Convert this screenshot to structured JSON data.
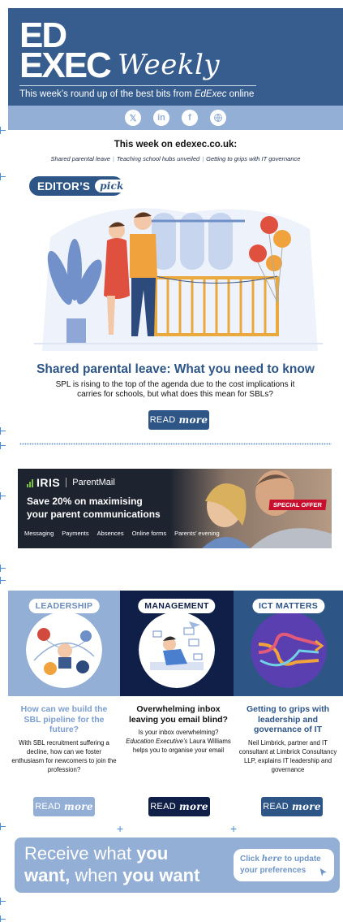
{
  "header": {
    "logo_line1": "ED",
    "logo_line2": "EXEC",
    "logo_script": "Weekly",
    "tagline_prefix": "This week’s round up of the best bits from ",
    "tagline_brand": "EdExec",
    "tagline_suffix": " online",
    "colors": {
      "masthead": "#365d8e",
      "social_bar": "#93afd6"
    }
  },
  "social": [
    {
      "icon": "x-icon",
      "glyph": "𝕏"
    },
    {
      "icon": "linkedin-icon",
      "glyph": "in"
    },
    {
      "icon": "facebook-icon",
      "glyph": "f"
    },
    {
      "icon": "globe-icon",
      "glyph": ""
    }
  ],
  "this_week": {
    "title": "This week on edexec.co.uk:",
    "links": [
      "Shared parental leave",
      "Teaching school hubs unveiled",
      "Getting to grips with IT governance"
    ],
    "separator": "|"
  },
  "editors_pick": {
    "badge_main": "EDITOR’S",
    "badge_script": "pick",
    "title": "Shared parental leave: What you need to know",
    "description": "SPL is rising to the top of the agenda due to the cost implications it carries for schools, but what does this mean for SBLs?",
    "read_label": "READ",
    "read_script": "more"
  },
  "ad": {
    "brand": "IRIS",
    "product": "ParentMail",
    "headline_line1": "Save 20% on maximising",
    "headline_line2": "your parent communications",
    "tags": [
      "Messaging",
      "Payments",
      "Absences",
      "Online forms",
      "Parents’ evening"
    ],
    "special_offer": "SPECIAL OFFER"
  },
  "columns": [
    {
      "tag": "LEADERSHIP",
      "title": "How can we build the SBL pipeline for the future?",
      "body": "With SBL recruitment suffering a decline, how can we foster enthusiasm for newcomers to join the profession?",
      "read_label": "READ",
      "read_script": "more",
      "color": "#93afd6"
    },
    {
      "tag": "MANAGEMENT",
      "title": "Overwhelming inbox leaving you email blind?",
      "body_prefix": "Is your inbox overwhelming? ",
      "body_italic": "Education Executive’s",
      "body_suffix": " Laura Williams helps you to organise your email",
      "read_label": "READ",
      "read_script": "more",
      "color": "#0f1f47"
    },
    {
      "tag": "ICT MATTERS",
      "title": "Getting to grips with leadership and governance of IT",
      "body": "Neil Limbrick, partner and IT consultant at Limbrick Consultancy LLP, explains IT leadership and governance",
      "read_label": "READ",
      "read_script": "more",
      "color": "#2d5586"
    }
  ],
  "preferences": {
    "line1_light": "Receive what ",
    "line1_bold": "you",
    "line2_bold": "want,",
    "line2_light": " when ",
    "line2_bold2": "you want",
    "btn_click": "Click ",
    "btn_here": "here",
    "btn_rest": " to update",
    "btn_line2": "your preferences"
  }
}
